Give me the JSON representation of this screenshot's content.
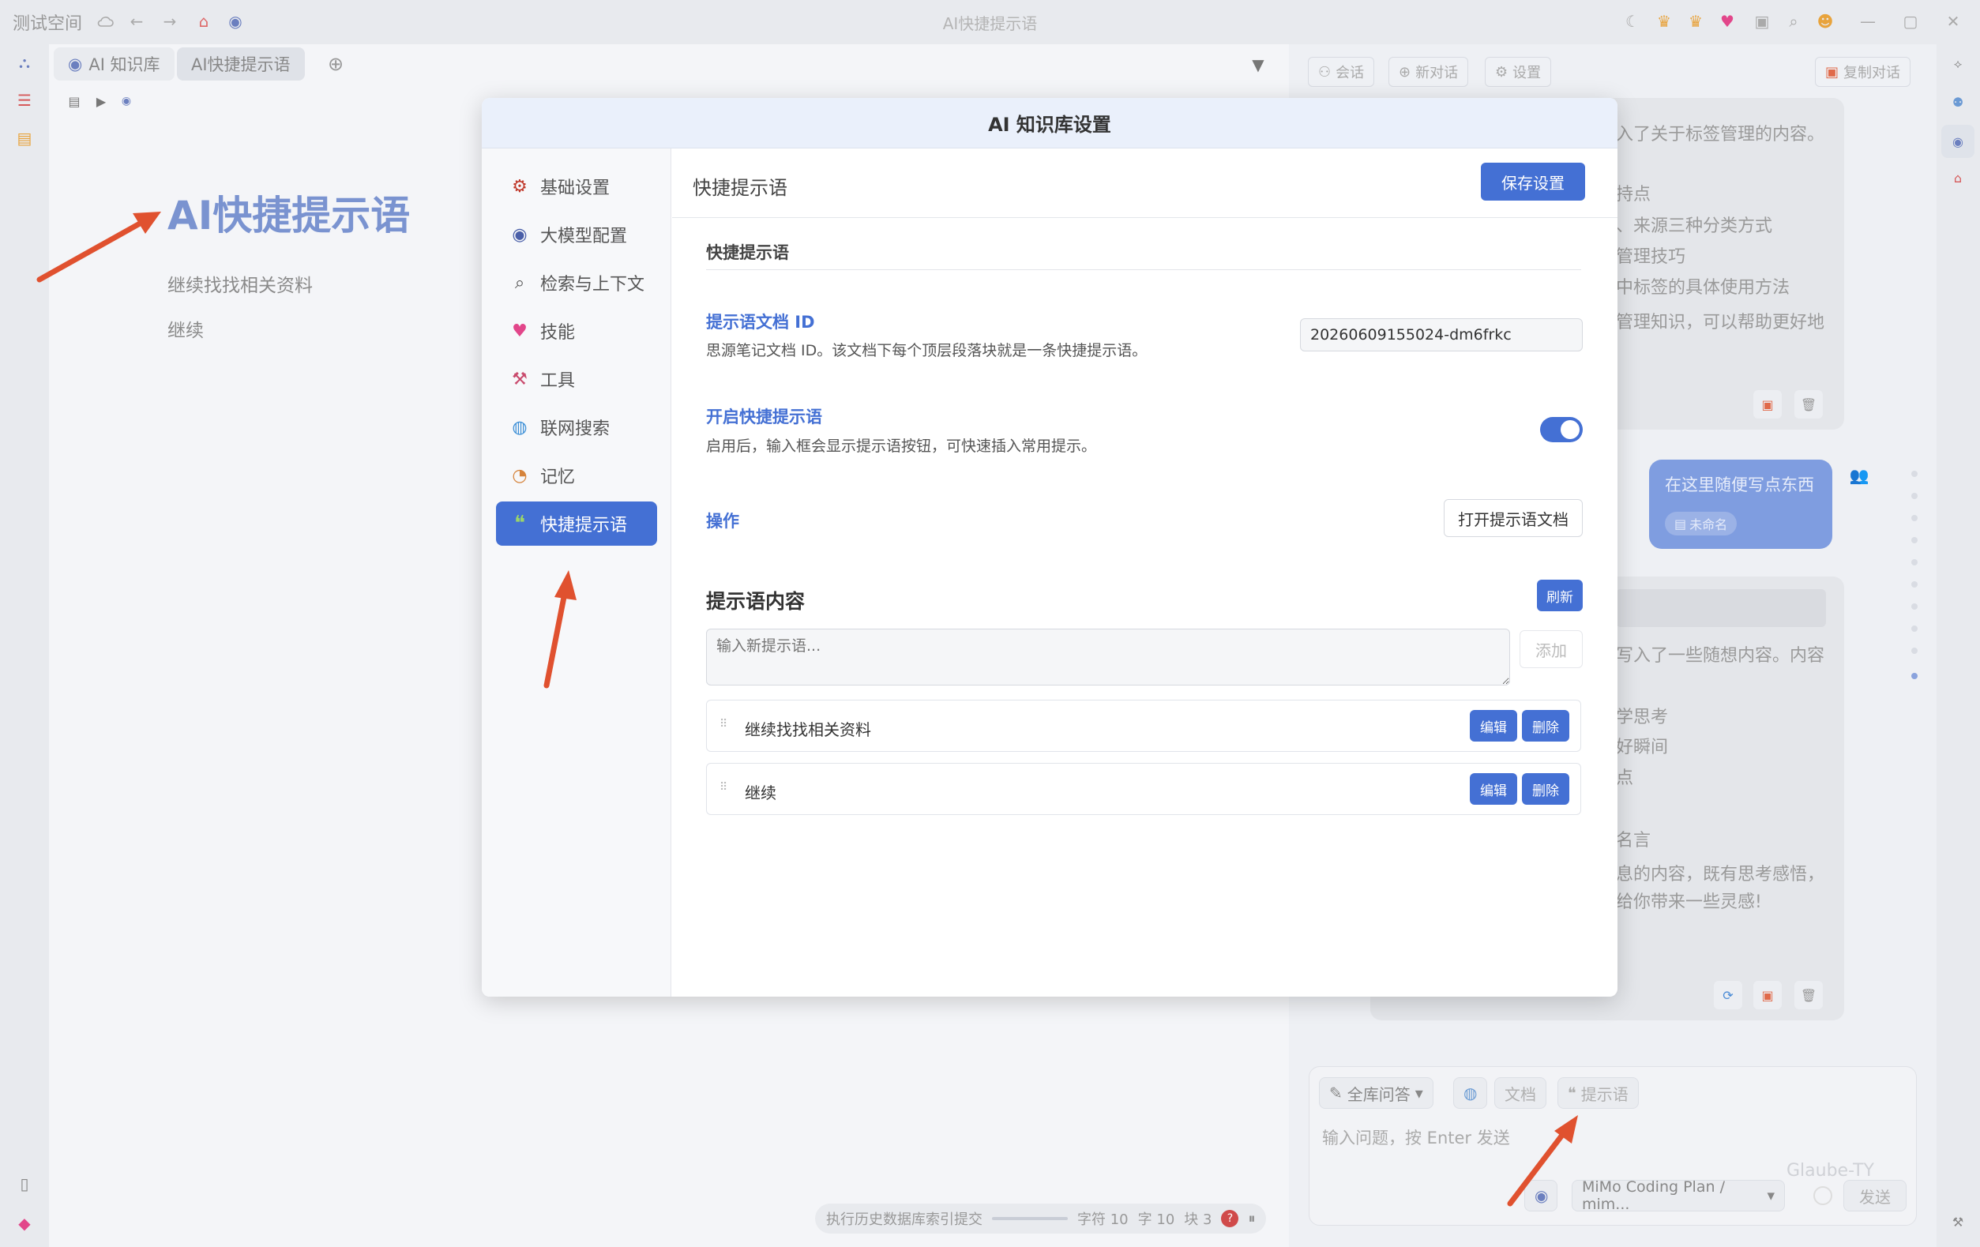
{
  "titlebar": {
    "workspace": "测试空间",
    "window_title": "AI快捷提示语"
  },
  "editor": {
    "tabs": [
      {
        "label": "AI 知识库"
      },
      {
        "label": "AI快捷提示语"
      }
    ],
    "doc_title": "AI快捷提示语",
    "doc_lines": [
      "继续找找相关资料",
      "继续"
    ],
    "status": {
      "indexing": "执行历史数据库索引提交",
      "chars": "字符 10",
      "words": "字 10",
      "blocks": "块 3"
    }
  },
  "right_panel": {
    "buttons": {
      "session": "会话",
      "new_chat": "新对话",
      "settings": "设置",
      "copy_chat": "复制对话"
    },
    "ai_msg1_lines": [
      "入了关于标签管理的内容。",
      "持点",
      "、来源三种分类方式",
      "管理技巧",
      "中标签的具体使用方法",
      "管理知识，可以帮助更好地"
    ],
    "user_msg": {
      "text": "在这里随便写点东西",
      "tag": "未命名"
    },
    "ai_msg2_lines": [
      "写入了一些随想内容。内容",
      "学思考",
      "好瞬间",
      "点",
      "名言",
      "息的内容，既有思考感悟，",
      "给你带来一些灵感!"
    ],
    "input": {
      "mode": "全库问答",
      "doc_btn": "文档",
      "prompt_btn": "提示语",
      "placeholder": "输入问题，按 Enter 发送",
      "model": "MiMo Coding Plan / mim...",
      "send": "发送",
      "watermark": "Glaube-TY"
    }
  },
  "modal": {
    "title": "AI 知识库设置",
    "nav": [
      {
        "label": "基础设置",
        "icon": "gear-icon"
      },
      {
        "label": "大模型配置",
        "icon": "robot-icon"
      },
      {
        "label": "检索与上下文",
        "icon": "search-icon"
      },
      {
        "label": "技能",
        "icon": "heart-icon"
      },
      {
        "label": "工具",
        "icon": "tool-icon"
      },
      {
        "label": "联网搜索",
        "icon": "globe-icon"
      },
      {
        "label": "记忆",
        "icon": "memory-icon"
      },
      {
        "label": "快捷提示语",
        "icon": "quote-icon"
      }
    ],
    "active_nav": 7,
    "section_title": "快捷提示语",
    "save_btn": "保存设置",
    "subsection": "快捷提示语",
    "doc_id": {
      "label": "提示语文档 ID",
      "desc": "思源笔记文档 ID。该文档下每个顶层段落块就是一条快捷提示语。",
      "value": "20260609155024-dm6frkc"
    },
    "enable": {
      "label": "开启快捷提示语",
      "desc": "启用后，输入框会显示提示语按钮，可快速插入常用提示。",
      "on": true
    },
    "ops": {
      "label": "操作",
      "open_doc_btn": "打开提示语文档"
    },
    "content": {
      "title": "提示语内容",
      "refresh_btn": "刷新",
      "placeholder": "输入新提示语...",
      "add_btn": "添加",
      "items": [
        {
          "text": "继续找找相关资料",
          "edit": "编辑",
          "delete": "删除"
        },
        {
          "text": "继续",
          "edit": "编辑",
          "delete": "删除"
        }
      ]
    }
  },
  "colors": {
    "accent": "#4470d4",
    "arrow": "#e0512f"
  }
}
